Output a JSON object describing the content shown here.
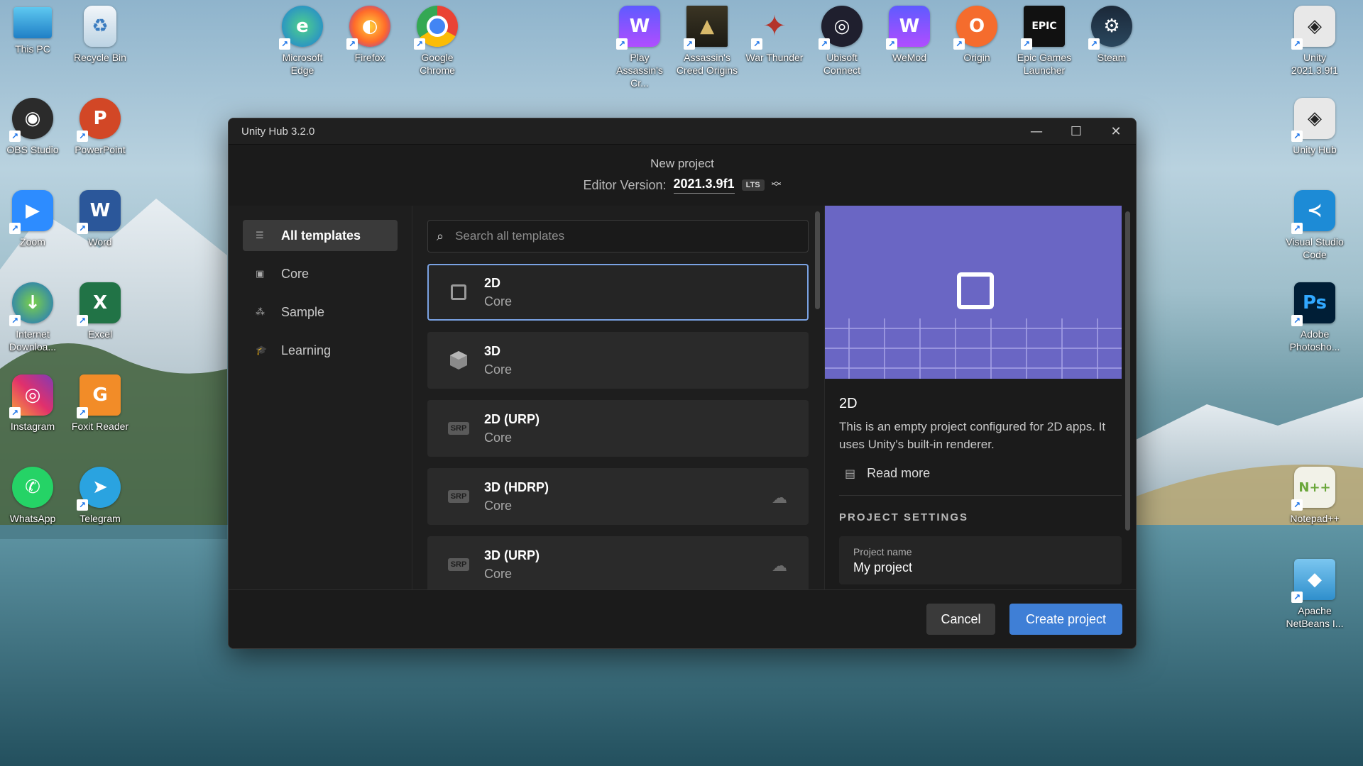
{
  "desktop": {
    "icons_left": [
      {
        "label": "This PC",
        "icon": "monitor-icon"
      },
      {
        "label": "Recycle Bin",
        "icon": "recycle-bin-icon"
      },
      {
        "label": "OBS Studio",
        "icon": "obs-icon"
      },
      {
        "label": "PowerPoint",
        "icon": "powerpoint-icon"
      },
      {
        "label": "Zoom",
        "icon": "zoom-icon"
      },
      {
        "label": "Word",
        "icon": "word-icon"
      },
      {
        "label": "Internet Downloa...",
        "icon": "idm-icon"
      },
      {
        "label": "Excel",
        "icon": "excel-icon"
      },
      {
        "label": "Instagram",
        "icon": "instagram-icon"
      },
      {
        "label": "Foxit Reader",
        "icon": "foxit-icon"
      },
      {
        "label": "WhatsApp",
        "icon": "whatsapp-icon"
      },
      {
        "label": "Telegram",
        "icon": "telegram-icon"
      }
    ],
    "icons_top": [
      {
        "label": "Microsoft Edge",
        "icon": "edge-icon"
      },
      {
        "label": "Firefox",
        "icon": "firefox-icon"
      },
      {
        "label": "Google Chrome",
        "icon": "chrome-icon"
      },
      {
        "label": "Play Assassin's Cr...",
        "icon": "wemod-play-icon"
      },
      {
        "label": "Assassin's Creed Origins",
        "icon": "assassins-creed-icon"
      },
      {
        "label": "War Thunder",
        "icon": "war-thunder-icon"
      },
      {
        "label": "Ubisoft Connect",
        "icon": "ubisoft-icon"
      },
      {
        "label": "WeMod",
        "icon": "wemod-icon"
      },
      {
        "label": "Origin",
        "icon": "origin-icon"
      },
      {
        "label": "Epic Games Launcher",
        "icon": "epic-games-icon"
      },
      {
        "label": "Steam",
        "icon": "steam-icon"
      }
    ],
    "icons_right": [
      {
        "label": "Unity 2021.3.9f1",
        "icon": "unity-icon"
      },
      {
        "label": "Unity Hub",
        "icon": "unity-hub-icon"
      },
      {
        "label": "Visual Studio Code",
        "icon": "vscode-icon"
      },
      {
        "label": "Adobe Photosho...",
        "icon": "photoshop-icon"
      },
      {
        "label": "Notepad++",
        "icon": "notepadpp-icon"
      },
      {
        "label": "Apache NetBeans I...",
        "icon": "netbeans-icon"
      }
    ]
  },
  "window": {
    "title": "Unity Hub 3.2.0",
    "controls": {
      "minimize": "—",
      "maximize": "☐",
      "close": "✕"
    }
  },
  "header": {
    "title": "New project",
    "editor_label": "Editor Version:",
    "editor_version": "2021.3.9f1",
    "badge": "LTS"
  },
  "sidebar": {
    "items": [
      {
        "label": "All templates",
        "icon": "list-icon",
        "active": true
      },
      {
        "label": "Core",
        "icon": "core-icon",
        "active": false
      },
      {
        "label": "Sample",
        "icon": "sample-icon",
        "active": false
      },
      {
        "label": "Learning",
        "icon": "learning-icon",
        "active": false
      }
    ]
  },
  "search": {
    "placeholder": "Search all templates",
    "value": ""
  },
  "templates": [
    {
      "name": "2D",
      "category": "Core",
      "icon": "square-outline-icon",
      "selected": true,
      "download": false
    },
    {
      "name": "3D",
      "category": "Core",
      "icon": "cube-icon",
      "selected": false,
      "download": false
    },
    {
      "name": "2D (URP)",
      "category": "Core",
      "icon": "srp-badge",
      "badge": "SRP",
      "selected": false,
      "download": false
    },
    {
      "name": "3D (HDRP)",
      "category": "Core",
      "icon": "srp-badge",
      "badge": "SRP",
      "selected": false,
      "download": true
    },
    {
      "name": "3D (URP)",
      "category": "Core",
      "icon": "srp-badge",
      "badge": "SRP",
      "selected": false,
      "download": true
    }
  ],
  "detail": {
    "title": "2D",
    "description": "This is an empty project configured for 2D apps. It uses Unity's built-in renderer.",
    "read_more": "Read more",
    "settings_title": "PROJECT SETTINGS",
    "project_name_label": "Project name",
    "project_name_value": "My project"
  },
  "footer": {
    "cancel": "Cancel",
    "create": "Create project"
  },
  "colors": {
    "accent": "#3f7fd6",
    "selected_border": "#7aa2e3",
    "preview_bg": "#6a66c4"
  }
}
